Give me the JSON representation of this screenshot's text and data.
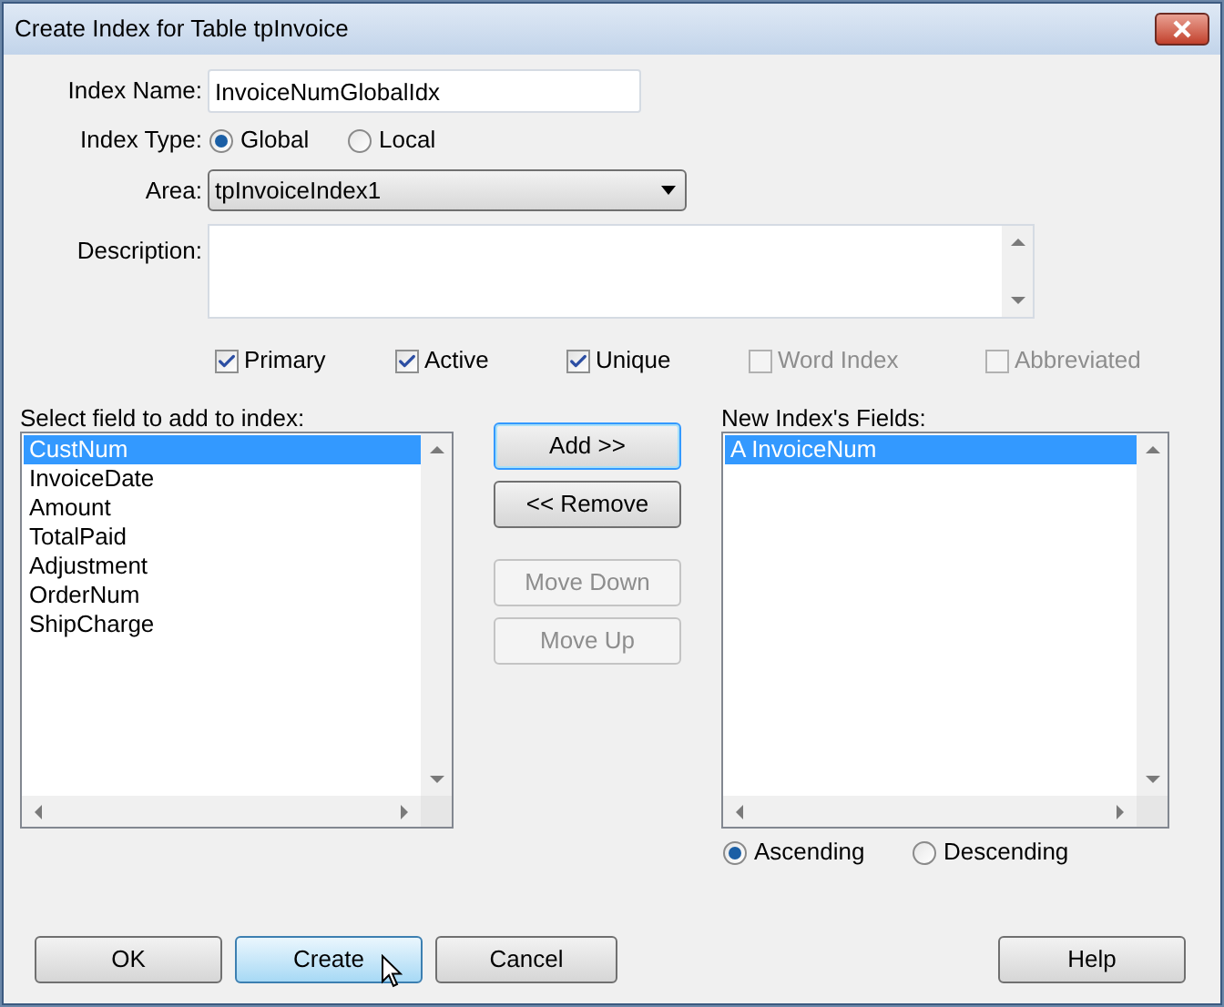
{
  "window": {
    "title": "Create Index for Table tpInvoice"
  },
  "index_name": {
    "label": "Index Name:",
    "value": "InvoiceNumGlobalIdx"
  },
  "index_type": {
    "label": "Index Type:",
    "options": [
      {
        "label": "Global",
        "selected": true
      },
      {
        "label": "Local",
        "selected": false
      }
    ]
  },
  "area": {
    "label": "Area:",
    "value": "tpInvoiceIndex1"
  },
  "description": {
    "label": "Description:"
  },
  "flags": [
    {
      "label": "Primary",
      "checked": true,
      "disabled": false
    },
    {
      "label": "Active",
      "checked": true,
      "disabled": false
    },
    {
      "label": "Unique",
      "checked": true,
      "disabled": false
    },
    {
      "label": "Word Index",
      "checked": false,
      "disabled": true
    },
    {
      "label": "Abbreviated",
      "checked": false,
      "disabled": true
    }
  ],
  "field_list": {
    "label": "Select field to add to index:",
    "items": [
      {
        "label": "CustNum",
        "selected": true
      },
      {
        "label": "InvoiceDate",
        "selected": false
      },
      {
        "label": "Amount",
        "selected": false
      },
      {
        "label": "TotalPaid",
        "selected": false
      },
      {
        "label": "Adjustment",
        "selected": false
      },
      {
        "label": "OrderNum",
        "selected": false
      },
      {
        "label": "ShipCharge",
        "selected": false
      }
    ]
  },
  "middle_buttons": [
    {
      "label": "Add >>",
      "default": true,
      "disabled": false
    },
    {
      "label": "<< Remove",
      "default": false,
      "disabled": false
    },
    {
      "label": "Move Down",
      "default": false,
      "disabled": true
    },
    {
      "label": "Move Up",
      "default": false,
      "disabled": true
    }
  ],
  "index_fields": {
    "label": "New Index's Fields:",
    "items": [
      {
        "order": "A",
        "name": "InvoiceNum",
        "selected": true
      }
    ]
  },
  "sort_order": [
    {
      "label": "Ascending",
      "selected": true
    },
    {
      "label": "Descending",
      "selected": false
    }
  ],
  "buttons": [
    {
      "label": "OK",
      "hovered": false
    },
    {
      "label": "Create",
      "hovered": true
    },
    {
      "label": "Cancel",
      "hovered": false
    },
    {
      "label": "Help",
      "hovered": false
    }
  ]
}
